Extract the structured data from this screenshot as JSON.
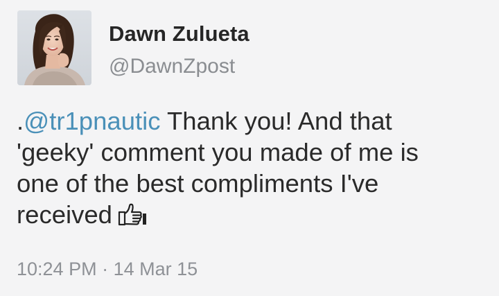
{
  "tweet": {
    "author": {
      "display_name": "Dawn Zulueta",
      "handle": "@DawnZpost"
    },
    "text": {
      "prefix": ".",
      "mention": "@tr1pnautic",
      "line1_rest": " Thank you! And that",
      "line2": "'geeky' comment you made of me is",
      "line3": "one of the best compliments I've",
      "line4": "received"
    },
    "emoji": "thumbs-up-icon",
    "meta": {
      "time": "10:24 PM",
      "separator": " · ",
      "date": "14 Mar 15"
    }
  },
  "colors": {
    "background": "#f4f4f5",
    "text": "#2a2a2a",
    "mention": "#4a90b8",
    "muted": "#8a8d91"
  }
}
